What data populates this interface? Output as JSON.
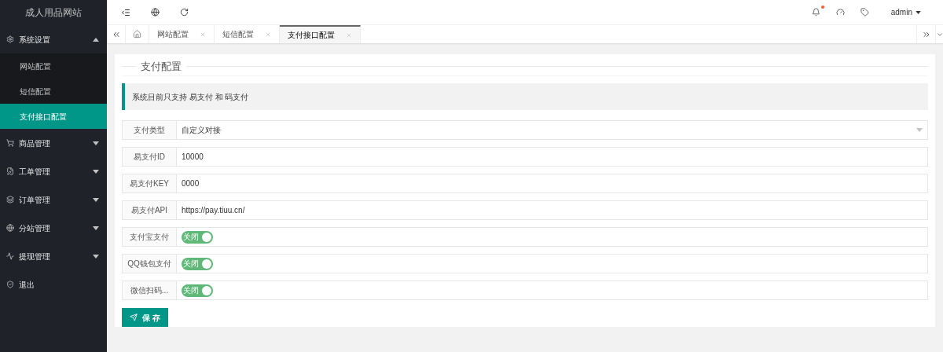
{
  "sidebar": {
    "logo": "成人用品网站",
    "items": [
      {
        "label": "系统设置",
        "expanded": true,
        "children": [
          {
            "label": "网站配置",
            "selected": false
          },
          {
            "label": "短信配置",
            "selected": false
          },
          {
            "label": "支付接口配置",
            "selected": true
          }
        ]
      },
      {
        "label": "商品管理",
        "expanded": false
      },
      {
        "label": "工单管理",
        "expanded": false
      },
      {
        "label": "订单管理",
        "expanded": false
      },
      {
        "label": "分站管理",
        "expanded": false
      },
      {
        "label": "提现管理",
        "expanded": false
      },
      {
        "label": "退出"
      }
    ]
  },
  "header": {
    "notification_dot": true,
    "user": "admin"
  },
  "tabs": [
    {
      "label": "网站配置",
      "selected": false
    },
    {
      "label": "短信配置",
      "selected": false
    },
    {
      "label": "支付接口配置",
      "selected": true
    }
  ],
  "form": {
    "legend": "支付配置",
    "notice": "系统目前只支持 易支付 和 码支付",
    "fields": [
      {
        "kind": "select",
        "label": "支付类型",
        "value": "自定义对接"
      },
      {
        "kind": "text",
        "label": "易支付ID",
        "value": "10000"
      },
      {
        "kind": "text",
        "label": "易支付KEY",
        "value": "0000"
      },
      {
        "kind": "text",
        "label": "易支付API",
        "value": "https://pay.tiuu.cn/"
      },
      {
        "kind": "switch",
        "label": "支付宝支付",
        "text": "关闭",
        "on": true
      },
      {
        "kind": "switch",
        "label": "QQ钱包支付",
        "text": "关闭",
        "on": true
      },
      {
        "kind": "switch",
        "label": "微信扫码...",
        "text": "关闭",
        "on": true
      }
    ],
    "save_button": "保 存"
  }
}
